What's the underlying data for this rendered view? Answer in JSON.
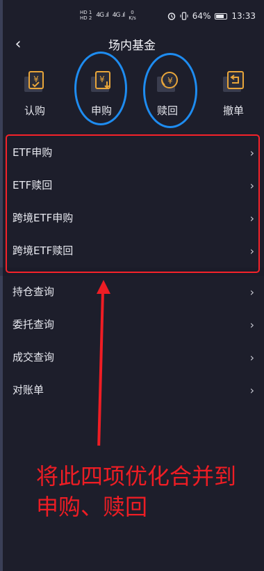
{
  "status_bar": {
    "sim1": "HD 1",
    "sim2": "HD 2",
    "signal1": "4G .ıl",
    "signal2": "4G .ıl",
    "net_speed": "0",
    "net_unit": "K/s",
    "alarm_icon": "alarm-clock-icon",
    "vibrate_icon": "vibrate-icon",
    "battery": "64%",
    "time": "13:33"
  },
  "header": {
    "back_icon": "chevron-left-icon",
    "back_glyph": "‹",
    "title": "场内基金"
  },
  "actions": [
    {
      "label": "认购",
      "icon": "subscribe-icon"
    },
    {
      "label": "申购",
      "icon": "purchase-icon"
    },
    {
      "label": "赎回",
      "icon": "redeem-icon"
    },
    {
      "label": "撤单",
      "icon": "cancel-order-icon"
    }
  ],
  "menu_group_1": [
    {
      "label": "ETF申购"
    },
    {
      "label": "ETF赎回"
    },
    {
      "label": "跨境ETF申购"
    },
    {
      "label": "跨境ETF赎回"
    }
  ],
  "menu_group_2": [
    {
      "label": "持仓查询"
    },
    {
      "label": "委托查询"
    },
    {
      "label": "成交查询"
    },
    {
      "label": "对账单"
    }
  ],
  "chevron_glyph": "›",
  "annotation": {
    "line1": "将此四项优化合并到",
    "line2": "申购、赎回"
  },
  "colors": {
    "background": "#1d1e2b",
    "annotation_red": "#ee1d24",
    "highlight_blue": "#1e8cf0",
    "icon_accent": "#e8a53a"
  }
}
